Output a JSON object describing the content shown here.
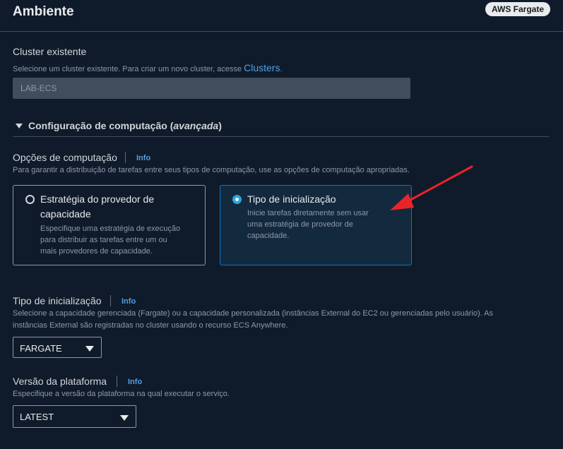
{
  "header": {
    "title": "Ambiente",
    "badge": "AWS Fargate"
  },
  "cluster": {
    "label": "Cluster existente",
    "description": "Selecione um cluster existente. Para criar um novo cluster, acesse",
    "link": "Clusters",
    "link_suffix": ".",
    "value": "LAB-ECS"
  },
  "compute_section": {
    "toggle_label": "Configuração de computação",
    "toggle_label_italic": "avançada",
    "options_label": "Opções de computação",
    "options_info": "Info",
    "options_description": "Para garantir a distribuição de tarefas entre seus tipos de computação, use as opções de computação apropriadas.",
    "cards": [
      {
        "title_line1": "Estratégia do provedor de",
        "title_line2": "capacidade",
        "desc_line1": "Especifique uma estratégia de execução",
        "desc_line2": "para distribuir as tarefas entre um ou",
        "desc_line3": "mais provedores de capacidade.",
        "selected": false
      },
      {
        "title_line1": "Tipo de inicialização",
        "desc_line1": "Inicie tarefas diretamente sem usar",
        "desc_line2": "uma estratégia de provedor de",
        "desc_line3": "capacidade.",
        "selected": true
      }
    ]
  },
  "launch_type": {
    "label": "Tipo de inicialização",
    "info": "Info",
    "description_line1": "Selecione a capacidade gerenciada (Fargate) ou a capacidade personalizada (instâncias External do EC2 ou gerenciadas pelo usuário). As",
    "description_line2": "instâncias External são registradas no cluster usando o recurso ECS Anywhere.",
    "value": "FARGATE"
  },
  "platform_version": {
    "label": "Versão da plataforma",
    "info": "Info",
    "description": "Especifique a versão da plataforma na qual executar o serviço.",
    "value": "LATEST"
  },
  "colors": {
    "background": "#0f1b2a",
    "accent": "#539fe5",
    "selected_border": "#0972d3",
    "annotation_arrow": "#e8242a"
  }
}
